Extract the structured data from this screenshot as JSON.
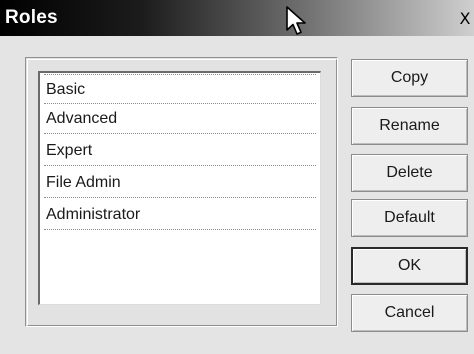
{
  "window": {
    "title": "Roles",
    "close_label": "X"
  },
  "roles": {
    "items": [
      {
        "label": "Basic"
      },
      {
        "label": "Advanced"
      },
      {
        "label": "Expert"
      },
      {
        "label": "File Admin"
      },
      {
        "label": "Administrator"
      }
    ]
  },
  "buttons": {
    "copy": "Copy",
    "rename": "Rename",
    "delete": "Delete",
    "default": "Default",
    "ok": "OK",
    "cancel": "Cancel"
  },
  "icons": {
    "close": "close-icon",
    "cursor": "mouse-pointer-icon"
  }
}
